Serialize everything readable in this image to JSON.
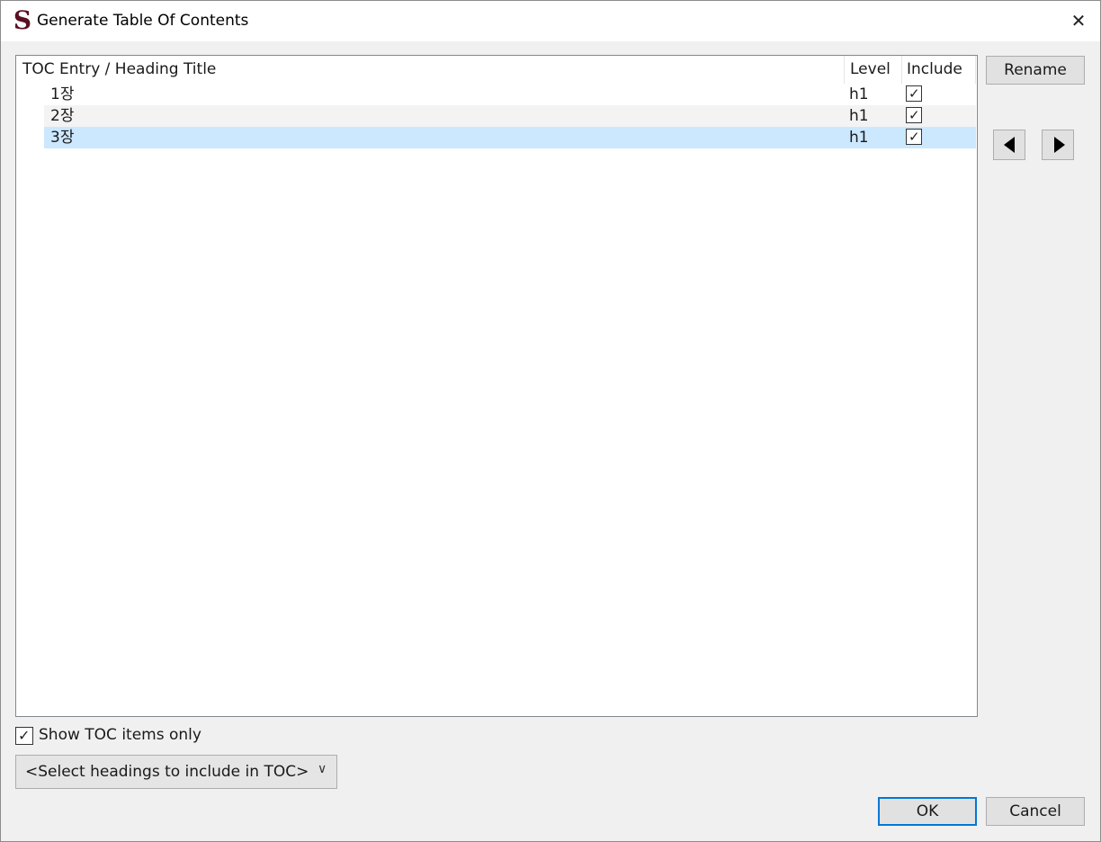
{
  "window": {
    "title": "Generate Table Of Contents",
    "icon": "S",
    "close_glyph": "✕"
  },
  "table": {
    "headers": {
      "title": "TOC Entry / Heading Title",
      "level": "Level",
      "include": "Include"
    },
    "rows": [
      {
        "title": "1장",
        "level": "h1",
        "include": true
      },
      {
        "title": "2장",
        "level": "h1",
        "include": true
      },
      {
        "title": "3장",
        "level": "h1",
        "include": true
      }
    ],
    "selected_row": 2
  },
  "side": {
    "rename_label": "Rename",
    "left_icon": "arrow-left-icon",
    "right_icon": "arrow-right-icon"
  },
  "options": {
    "show_toc_only_label": "Show TOC items only",
    "show_toc_only_checked": true,
    "headings_select": "<Select headings to include in TOC>"
  },
  "footer": {
    "ok_label": "OK",
    "cancel_label": "Cancel"
  },
  "colors": {
    "selection": "#cce8ff",
    "ok_focus_border": "#0078d7"
  }
}
